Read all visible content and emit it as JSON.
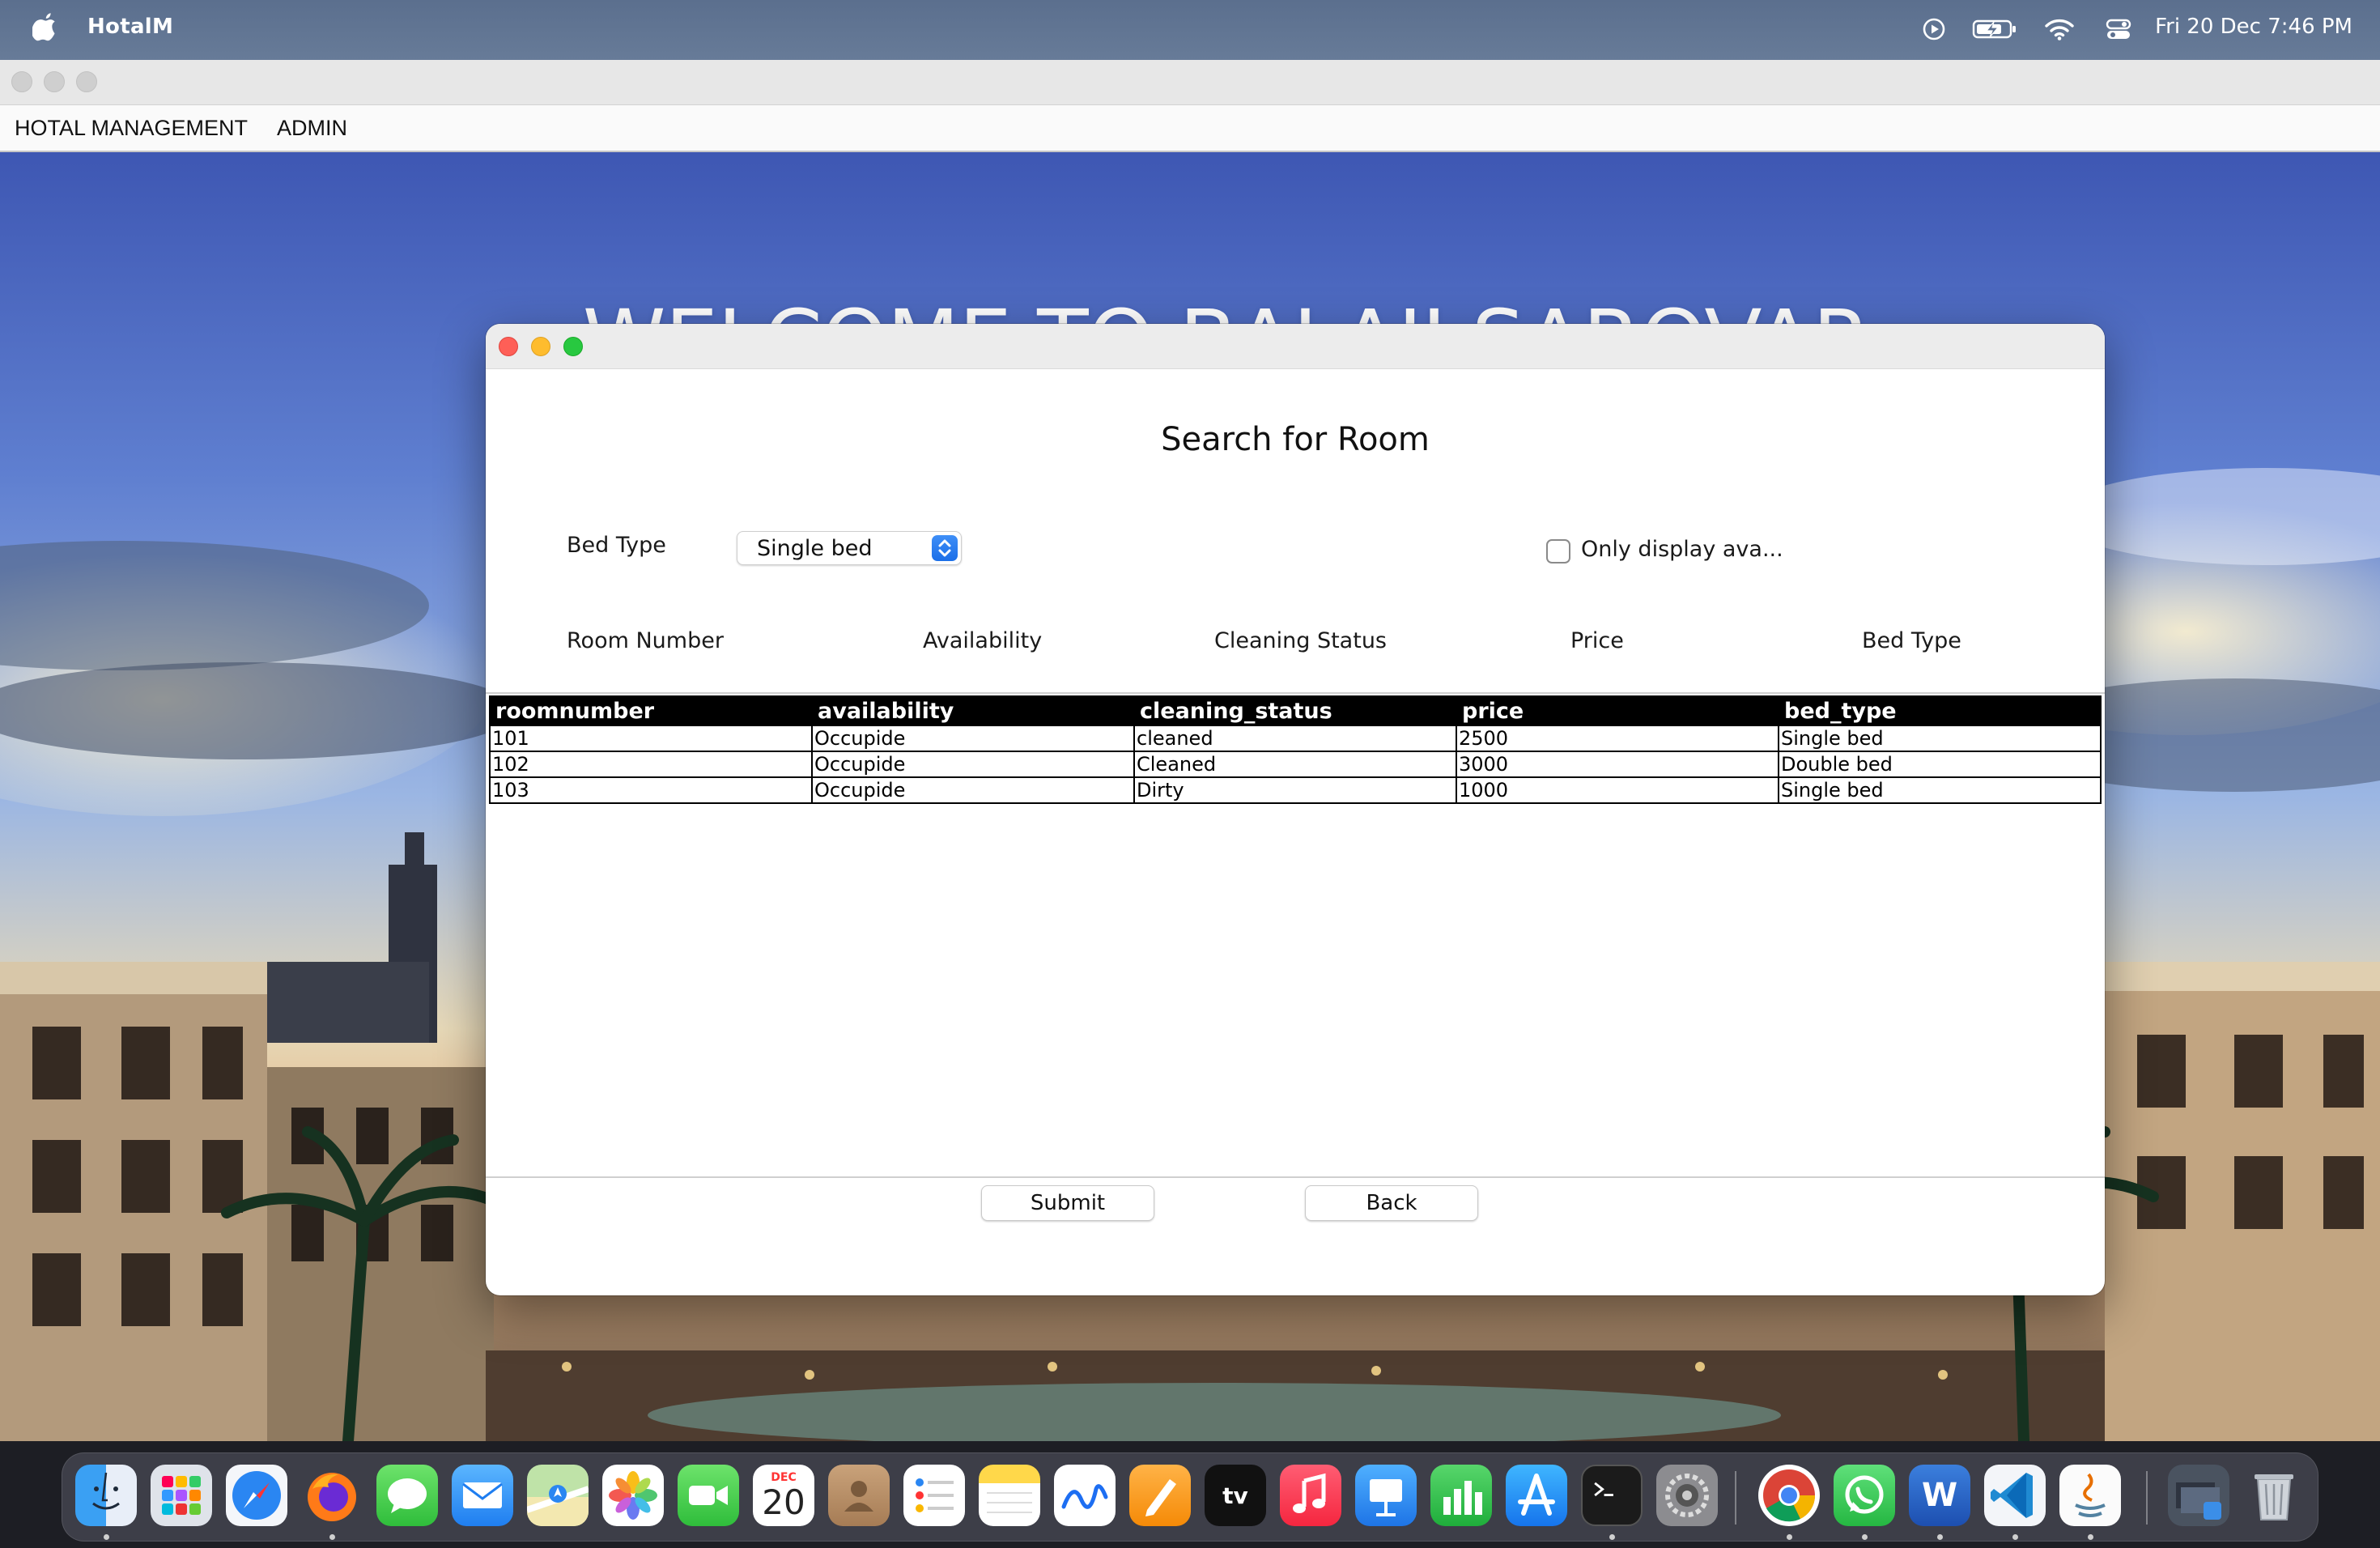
{
  "menubar": {
    "app_name": "HotalM",
    "clock_text": "Fri 20 Dec  7:46 PM"
  },
  "app_menu": {
    "items": [
      "HOTAL MANAGEMENT",
      "ADMIN"
    ]
  },
  "backdrop": {
    "welcome_text": "WELCOME TO BALAJI SAROVAR"
  },
  "dialog": {
    "title": "Search for Room",
    "bed_type_label": "Bed Type",
    "bed_type_value": "Single bed",
    "only_available_label": "Only display ava...",
    "only_available_checked": false,
    "field_labels": {
      "room_number": "Room Number",
      "availability": "Availability",
      "cleaning_status": "Cleaning Status",
      "price": "Price",
      "bed_type": "Bed Type"
    },
    "table": {
      "headers": [
        "roomnumber",
        "availability",
        "cleaning_status",
        "price",
        "bed_type"
      ],
      "rows": [
        [
          "101",
          "Occupide",
          "cleaned",
          "2500",
          "Single bed"
        ],
        [
          "102",
          "Occupide",
          "Cleaned",
          "3000",
          "Double bed"
        ],
        [
          "103",
          "Occupide",
          "Dirty",
          "1000",
          "Single bed"
        ]
      ]
    },
    "submit_label": "Submit",
    "back_label": "Back"
  },
  "dock": {
    "calendar_month": "DEC",
    "calendar_day": "20",
    "tv_label": "tv",
    "word_label": "W",
    "apps": [
      "finder",
      "launchpad",
      "safari",
      "firefox",
      "messages",
      "mail",
      "maps",
      "photos",
      "facetime",
      "calendar",
      "contacts",
      "reminders",
      "notes",
      "freeform",
      "pages",
      "apple-tv",
      "music",
      "keynote",
      "numbers",
      "app-store",
      "terminal",
      "system-settings",
      "chrome",
      "whatsapp",
      "word",
      "vscode",
      "java",
      "downloads",
      "trash"
    ]
  }
}
